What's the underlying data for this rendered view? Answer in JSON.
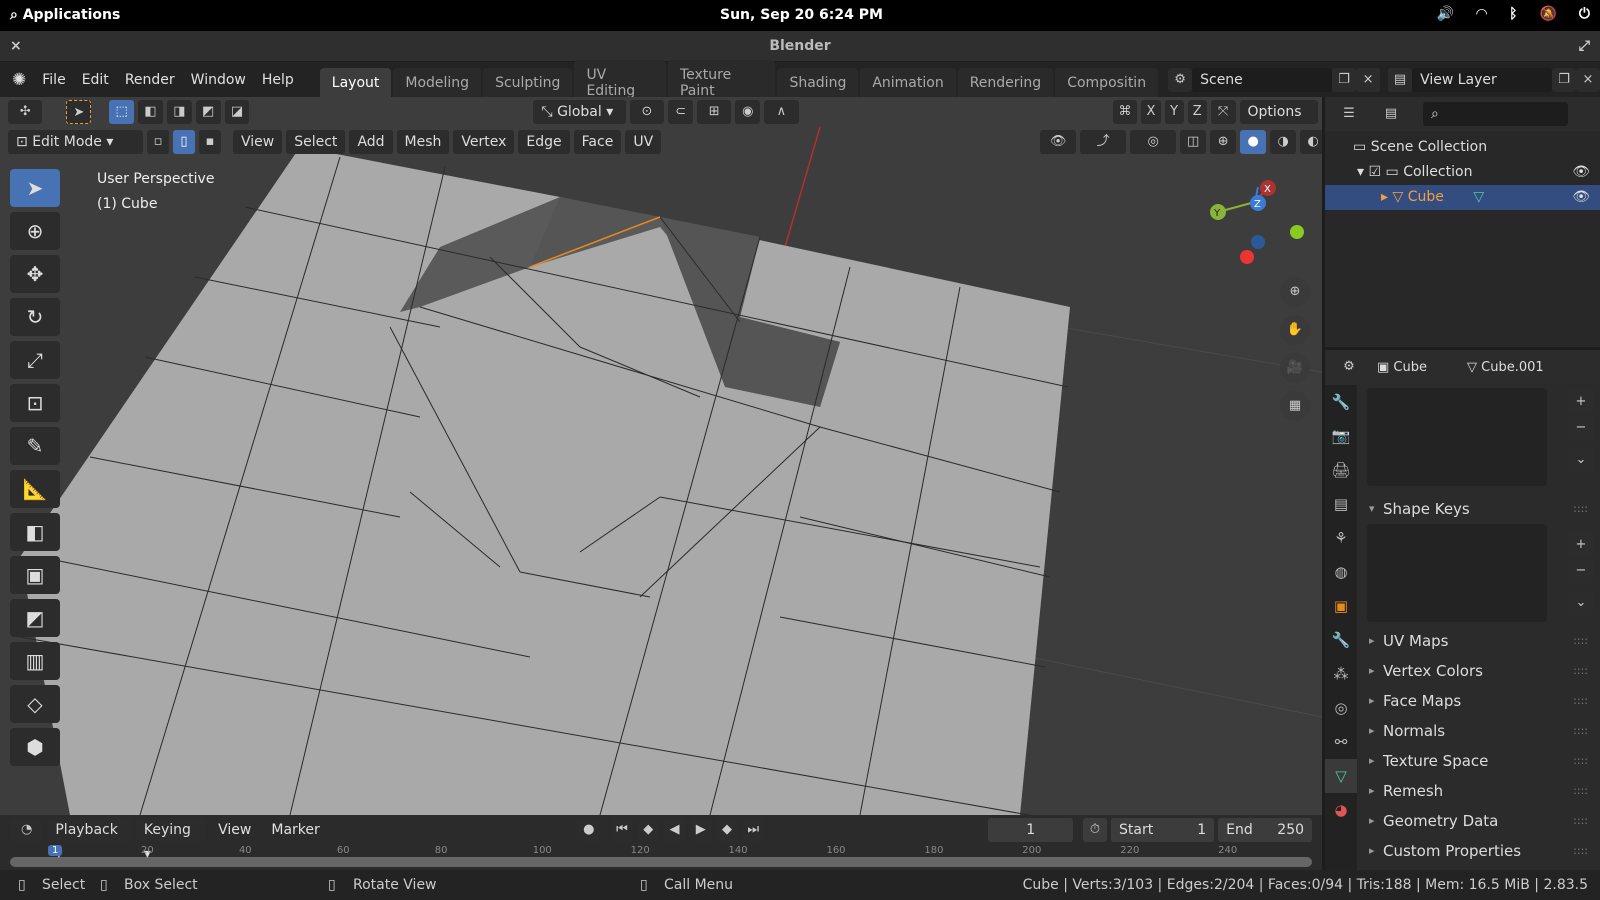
{
  "os": {
    "apps": "Applications",
    "clock": "Sun, Sep 20  6:24 PM",
    "tray_icons": [
      "volume-icon",
      "wifi-icon",
      "bluetooth-icon",
      "notifications-off-icon",
      "power-icon"
    ]
  },
  "window": {
    "title": "Blender"
  },
  "menubar": {
    "menus": [
      "File",
      "Edit",
      "Render",
      "Window",
      "Help"
    ],
    "workspaces": [
      "Layout",
      "Modeling",
      "Sculpting",
      "UV Editing",
      "Texture Paint",
      "Shading",
      "Animation",
      "Rendering",
      "Compositin"
    ],
    "active_workspace": "Layout",
    "scene": "Scene",
    "view_layer": "View Layer"
  },
  "viewport": {
    "transform_orientation": "Global",
    "options": "Options",
    "axes": [
      "X",
      "Y",
      "Z"
    ],
    "mode": "Edit Mode",
    "menus": [
      "View",
      "Select",
      "Add",
      "Mesh",
      "Vertex",
      "Edge",
      "Face",
      "UV"
    ],
    "overlay_line1": "User Perspective",
    "overlay_line2": "(1) Cube",
    "gizmo": {
      "x": "X",
      "y": "Y",
      "z": "Z"
    },
    "accent": "#4772b3",
    "selected_edge_color": "#e8891c"
  },
  "outliner": {
    "search_placeholder": "",
    "scene_collection": "Scene Collection",
    "collection": "Collection",
    "object": "Cube"
  },
  "properties": {
    "object": "Cube",
    "mesh": "Cube.001",
    "sections": [
      {
        "label": "Shape Keys",
        "open": true
      },
      {
        "label": "UV Maps"
      },
      {
        "label": "Vertex Colors"
      },
      {
        "label": "Face Maps"
      },
      {
        "label": "Normals"
      },
      {
        "label": "Texture Space"
      },
      {
        "label": "Remesh"
      },
      {
        "label": "Geometry Data"
      },
      {
        "label": "Custom Properties"
      }
    ]
  },
  "timeline": {
    "menus": [
      "Playback",
      "Keying",
      "View",
      "Marker"
    ],
    "current_frame": "1",
    "start_label": "Start",
    "start": "1",
    "end_label": "End",
    "end": "250",
    "ticks": [
      "1",
      "20",
      "40",
      "60",
      "80",
      "100",
      "120",
      "140",
      "160",
      "180",
      "200",
      "220",
      "240"
    ]
  },
  "status": {
    "select": "Select",
    "box_select": "Box Select",
    "rotate": "Rotate View",
    "call_menu": "Call Menu",
    "stats": "Cube | Verts:3/103 | Edges:2/204 | Faces:0/94 | Tris:188 | Mem: 16.5 MiB | 2.83.5"
  }
}
